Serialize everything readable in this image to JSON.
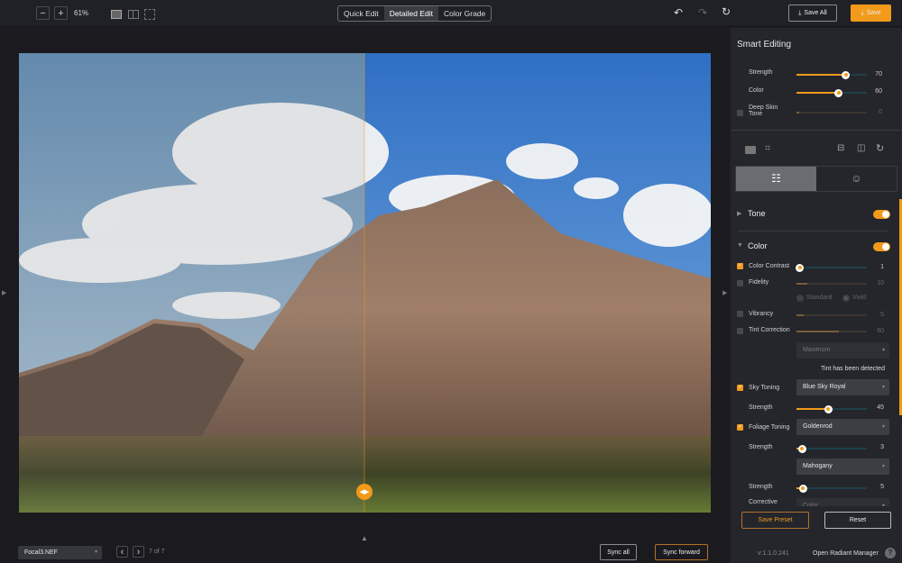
{
  "toolbar": {
    "zoom_out": "−",
    "zoom_in": "+",
    "zoom_level": "61%",
    "modes": [
      "Quick Edit",
      "Detailed Edit",
      "Color Grade"
    ],
    "active_mode": "Detailed Edit",
    "save_all": "Save All",
    "save": "Save"
  },
  "smart_editing": {
    "title": "Smart Editing",
    "strength": {
      "label": "Strength",
      "value": 70
    },
    "color": {
      "label": "Color",
      "value": 60
    },
    "deep_skin": {
      "label": "Deep Skin Tone",
      "value": 0,
      "checked": false
    }
  },
  "sections": {
    "tone": "Tone",
    "color": "Color"
  },
  "color": {
    "contrast": {
      "label": "Color Contrast",
      "value": 1,
      "checked": true
    },
    "fidelity": {
      "label": "Fidelity",
      "value": 10,
      "checked": false,
      "options": [
        "Standard",
        "Vivid"
      ]
    },
    "vibrancy": {
      "label": "Vibrancy",
      "value": 5,
      "checked": false
    },
    "tint": {
      "label": "Tint Correction",
      "value": 60,
      "checked": false,
      "mode": "Maximum",
      "note": "Tint has been detected"
    },
    "sky": {
      "label": "Sky Toning",
      "preset": "Blue Sky Royal",
      "strength_label": "Strength",
      "strength": 45,
      "checked": true
    },
    "foliage": {
      "label": "Foliage Toning",
      "preset": "Goldenrod",
      "strength_label": "Strength",
      "strength": 3,
      "preset2": "Mahogany",
      "strength2_label": "Strength",
      "strength2": 5,
      "checked": true
    },
    "corrective": {
      "label": "Corrective",
      "value": "Color"
    }
  },
  "footer": {
    "save_preset": "Save Preset",
    "reset": "Reset",
    "version": "v:1.1.0.241",
    "manager": "Open Radiant Manager",
    "help": "?"
  },
  "bottom": {
    "file": "Focal3.NEF",
    "page": "7 of 7",
    "sync_all": "Sync all",
    "sync_forward": "Sync forward"
  },
  "colors": {
    "accent": "#f29a1a"
  }
}
